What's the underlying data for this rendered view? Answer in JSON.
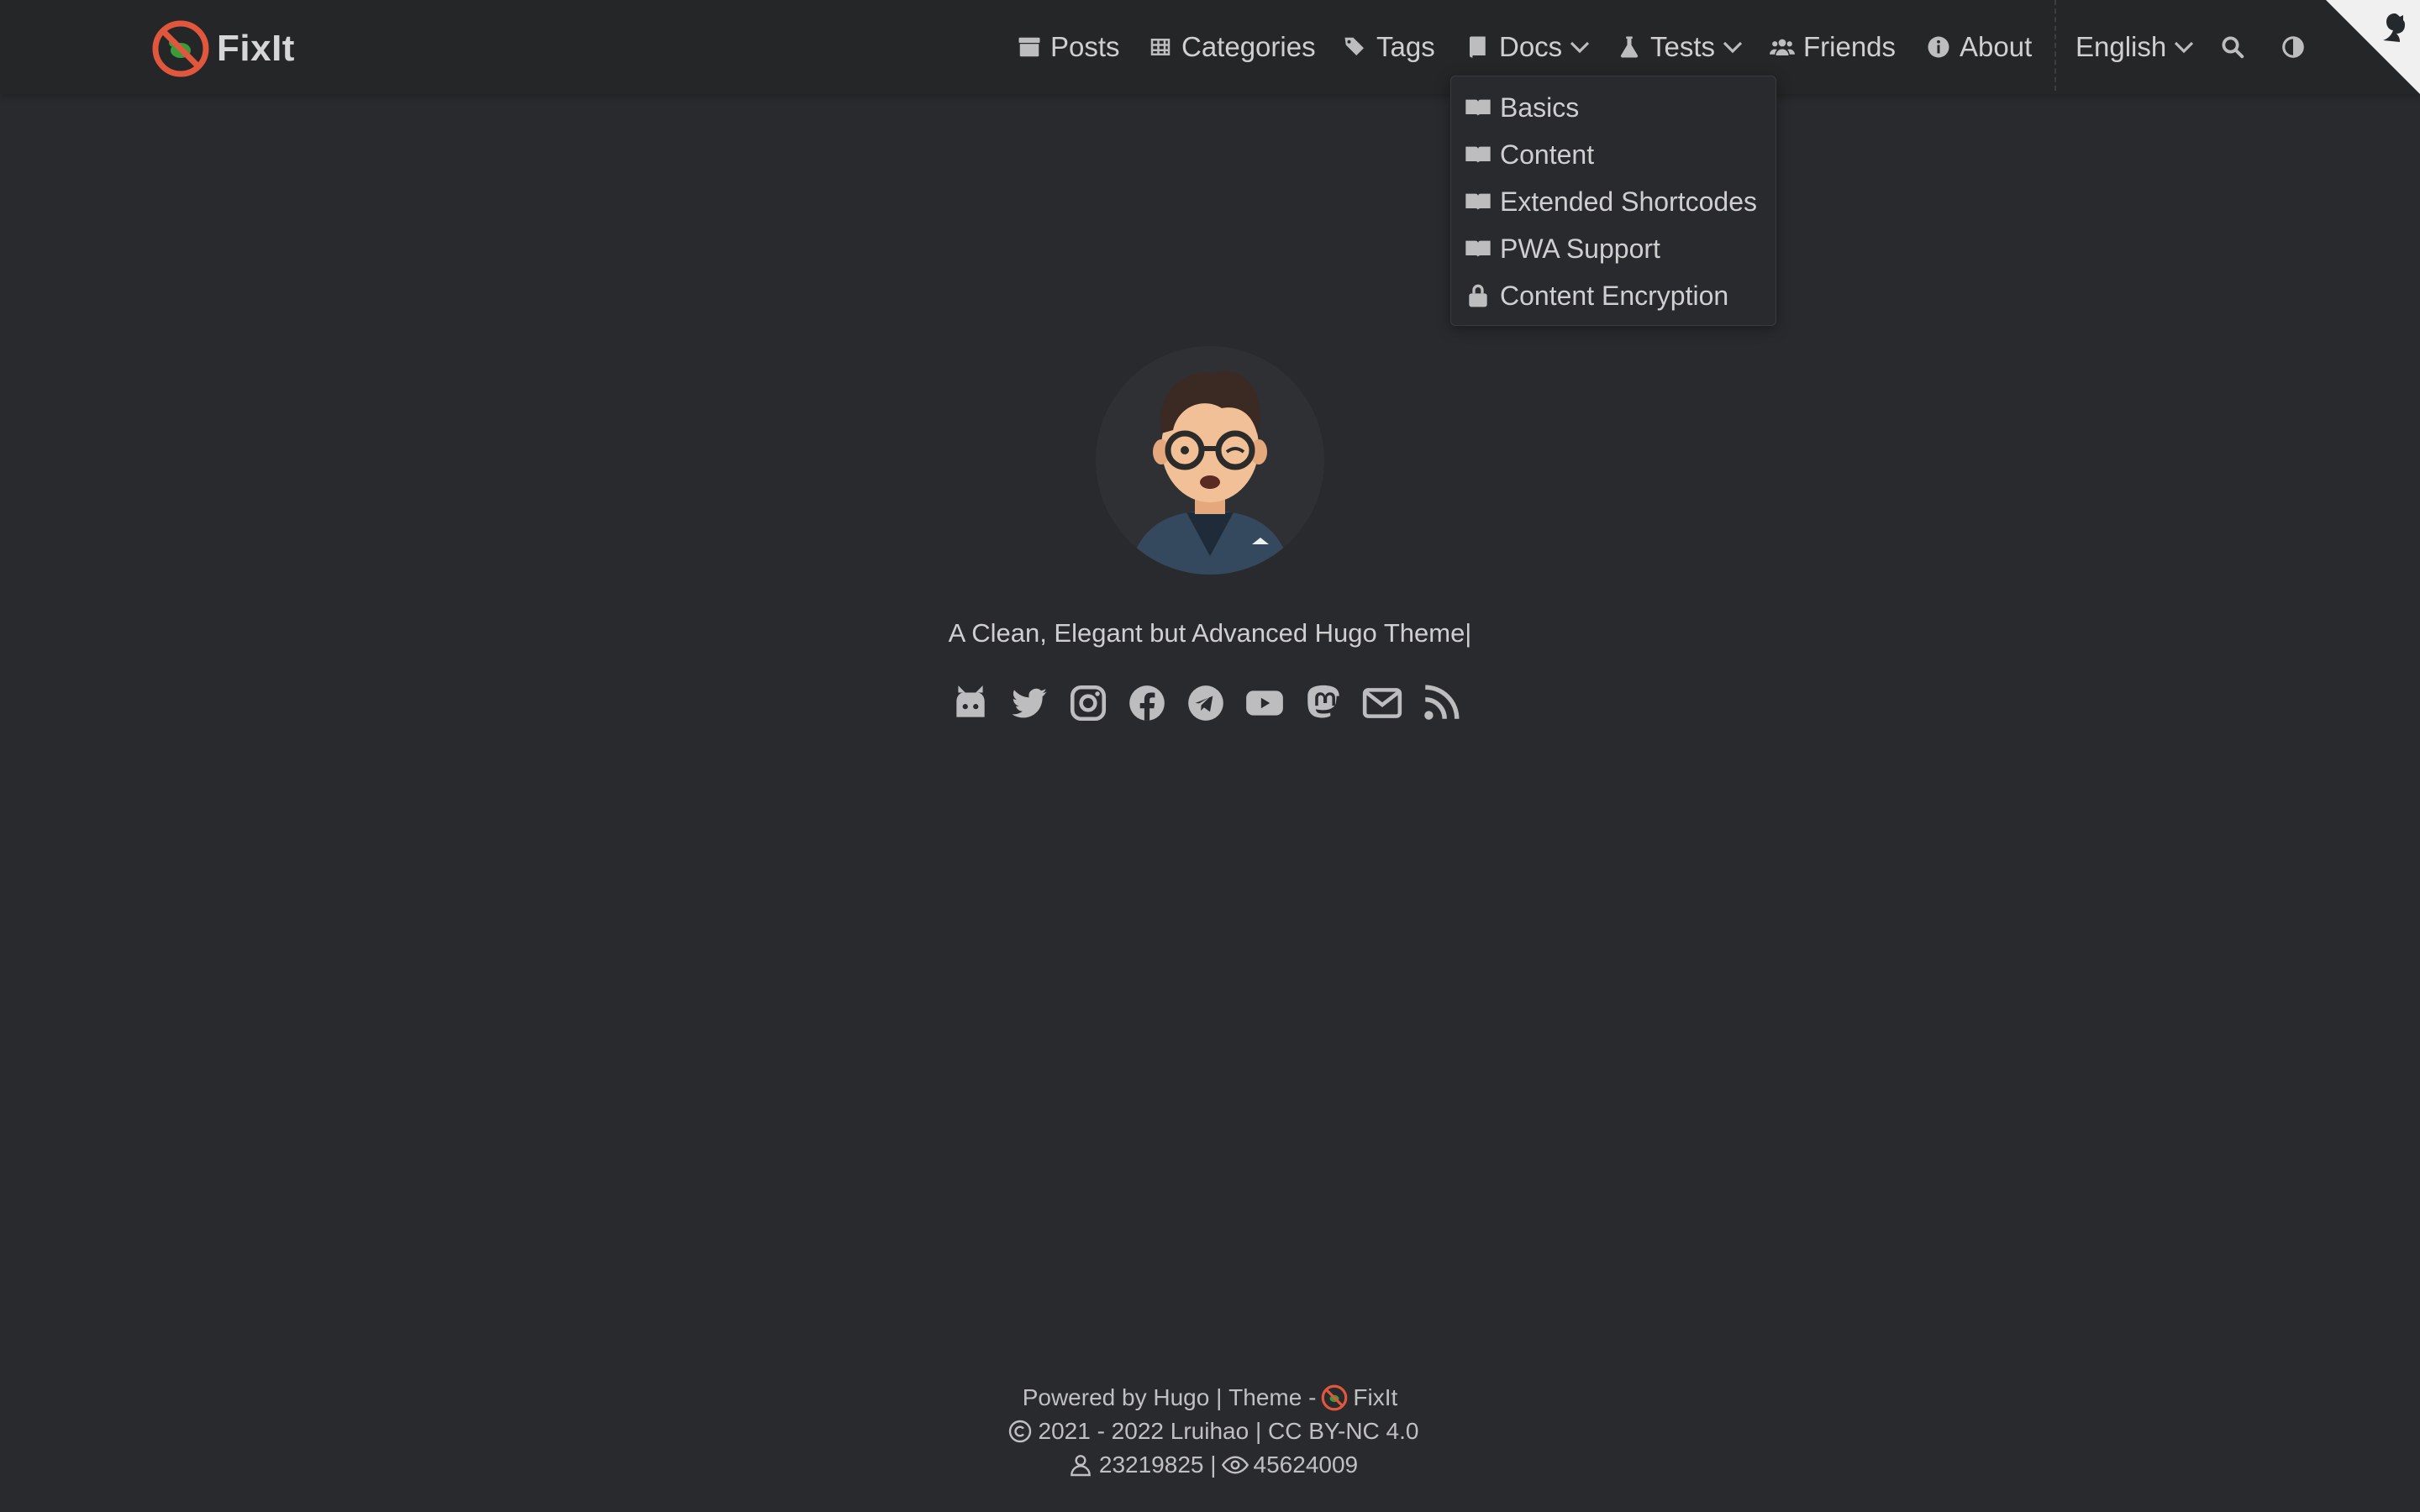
{
  "brand": {
    "name": "FixIt"
  },
  "nav": {
    "posts": "Posts",
    "categories": "Categories",
    "tags": "Tags",
    "docs": "Docs",
    "tests": "Tests",
    "friends": "Friends",
    "about": "About",
    "language": "English"
  },
  "docs_menu": [
    {
      "label": "Basics",
      "icon": "book-open-icon"
    },
    {
      "label": "Content",
      "icon": "book-open-icon"
    },
    {
      "label": "Extended Shortcodes",
      "icon": "book-open-icon"
    },
    {
      "label": "PWA Support",
      "icon": "book-open-icon"
    },
    {
      "label": "Content Encryption",
      "icon": "lock-icon"
    }
  ],
  "home": {
    "subtitle": "A Clean, Elegant but Advanced Hugo Theme|"
  },
  "social": [
    "github-icon",
    "twitter-icon",
    "instagram-icon",
    "facebook-icon",
    "telegram-icon",
    "youtube-icon",
    "mastodon-icon",
    "email-icon",
    "rss-icon"
  ],
  "footer": {
    "powered_by": "Powered by",
    "hugo": "Hugo",
    "sep1": "|",
    "theme_label": "Theme -",
    "theme_name": "FixIt",
    "copyright": "2021 - 2022",
    "author": "Lruihao",
    "sep2": "|",
    "license": "CC BY-NC 4.0",
    "visitors": "23219825",
    "sep3": "|",
    "views": "45624009"
  },
  "colors": {
    "background": "#292a2d",
    "header": "#252627",
    "text": "#c9c9cb",
    "logo_red": "#e0573d",
    "logo_green": "#3b9b3b"
  }
}
